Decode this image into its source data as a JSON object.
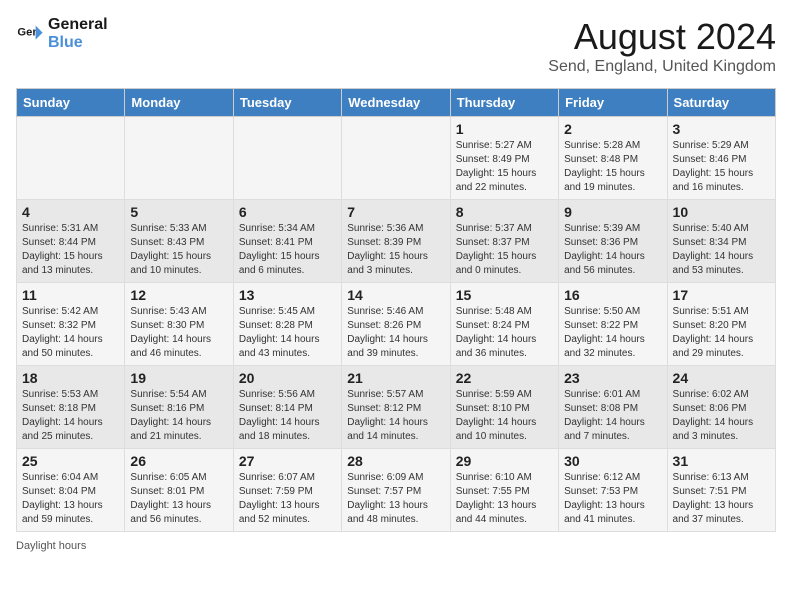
{
  "header": {
    "logo_line1": "General",
    "logo_line2": "Blue",
    "main_title": "August 2024",
    "subtitle": "Send, England, United Kingdom"
  },
  "days_of_week": [
    "Sunday",
    "Monday",
    "Tuesday",
    "Wednesday",
    "Thursday",
    "Friday",
    "Saturday"
  ],
  "weeks": [
    [
      {
        "day": "",
        "sunrise": "",
        "sunset": "",
        "daylight": ""
      },
      {
        "day": "",
        "sunrise": "",
        "sunset": "",
        "daylight": ""
      },
      {
        "day": "",
        "sunrise": "",
        "sunset": "",
        "daylight": ""
      },
      {
        "day": "",
        "sunrise": "",
        "sunset": "",
        "daylight": ""
      },
      {
        "day": "1",
        "sunrise": "5:27 AM",
        "sunset": "8:49 PM",
        "daylight": "15 hours and 22 minutes."
      },
      {
        "day": "2",
        "sunrise": "5:28 AM",
        "sunset": "8:48 PM",
        "daylight": "15 hours and 19 minutes."
      },
      {
        "day": "3",
        "sunrise": "5:29 AM",
        "sunset": "8:46 PM",
        "daylight": "15 hours and 16 minutes."
      }
    ],
    [
      {
        "day": "4",
        "sunrise": "5:31 AM",
        "sunset": "8:44 PM",
        "daylight": "15 hours and 13 minutes."
      },
      {
        "day": "5",
        "sunrise": "5:33 AM",
        "sunset": "8:43 PM",
        "daylight": "15 hours and 10 minutes."
      },
      {
        "day": "6",
        "sunrise": "5:34 AM",
        "sunset": "8:41 PM",
        "daylight": "15 hours and 6 minutes."
      },
      {
        "day": "7",
        "sunrise": "5:36 AM",
        "sunset": "8:39 PM",
        "daylight": "15 hours and 3 minutes."
      },
      {
        "day": "8",
        "sunrise": "5:37 AM",
        "sunset": "8:37 PM",
        "daylight": "15 hours and 0 minutes."
      },
      {
        "day": "9",
        "sunrise": "5:39 AM",
        "sunset": "8:36 PM",
        "daylight": "14 hours and 56 minutes."
      },
      {
        "day": "10",
        "sunrise": "5:40 AM",
        "sunset": "8:34 PM",
        "daylight": "14 hours and 53 minutes."
      }
    ],
    [
      {
        "day": "11",
        "sunrise": "5:42 AM",
        "sunset": "8:32 PM",
        "daylight": "14 hours and 50 minutes."
      },
      {
        "day": "12",
        "sunrise": "5:43 AM",
        "sunset": "8:30 PM",
        "daylight": "14 hours and 46 minutes."
      },
      {
        "day": "13",
        "sunrise": "5:45 AM",
        "sunset": "8:28 PM",
        "daylight": "14 hours and 43 minutes."
      },
      {
        "day": "14",
        "sunrise": "5:46 AM",
        "sunset": "8:26 PM",
        "daylight": "14 hours and 39 minutes."
      },
      {
        "day": "15",
        "sunrise": "5:48 AM",
        "sunset": "8:24 PM",
        "daylight": "14 hours and 36 minutes."
      },
      {
        "day": "16",
        "sunrise": "5:50 AM",
        "sunset": "8:22 PM",
        "daylight": "14 hours and 32 minutes."
      },
      {
        "day": "17",
        "sunrise": "5:51 AM",
        "sunset": "8:20 PM",
        "daylight": "14 hours and 29 minutes."
      }
    ],
    [
      {
        "day": "18",
        "sunrise": "5:53 AM",
        "sunset": "8:18 PM",
        "daylight": "14 hours and 25 minutes."
      },
      {
        "day": "19",
        "sunrise": "5:54 AM",
        "sunset": "8:16 PM",
        "daylight": "14 hours and 21 minutes."
      },
      {
        "day": "20",
        "sunrise": "5:56 AM",
        "sunset": "8:14 PM",
        "daylight": "14 hours and 18 minutes."
      },
      {
        "day": "21",
        "sunrise": "5:57 AM",
        "sunset": "8:12 PM",
        "daylight": "14 hours and 14 minutes."
      },
      {
        "day": "22",
        "sunrise": "5:59 AM",
        "sunset": "8:10 PM",
        "daylight": "14 hours and 10 minutes."
      },
      {
        "day": "23",
        "sunrise": "6:01 AM",
        "sunset": "8:08 PM",
        "daylight": "14 hours and 7 minutes."
      },
      {
        "day": "24",
        "sunrise": "6:02 AM",
        "sunset": "8:06 PM",
        "daylight": "14 hours and 3 minutes."
      }
    ],
    [
      {
        "day": "25",
        "sunrise": "6:04 AM",
        "sunset": "8:04 PM",
        "daylight": "13 hours and 59 minutes."
      },
      {
        "day": "26",
        "sunrise": "6:05 AM",
        "sunset": "8:01 PM",
        "daylight": "13 hours and 56 minutes."
      },
      {
        "day": "27",
        "sunrise": "6:07 AM",
        "sunset": "7:59 PM",
        "daylight": "13 hours and 52 minutes."
      },
      {
        "day": "28",
        "sunrise": "6:09 AM",
        "sunset": "7:57 PM",
        "daylight": "13 hours and 48 minutes."
      },
      {
        "day": "29",
        "sunrise": "6:10 AM",
        "sunset": "7:55 PM",
        "daylight": "13 hours and 44 minutes."
      },
      {
        "day": "30",
        "sunrise": "6:12 AM",
        "sunset": "7:53 PM",
        "daylight": "13 hours and 41 minutes."
      },
      {
        "day": "31",
        "sunrise": "6:13 AM",
        "sunset": "7:51 PM",
        "daylight": "13 hours and 37 minutes."
      }
    ]
  ],
  "footer": "Daylight hours"
}
